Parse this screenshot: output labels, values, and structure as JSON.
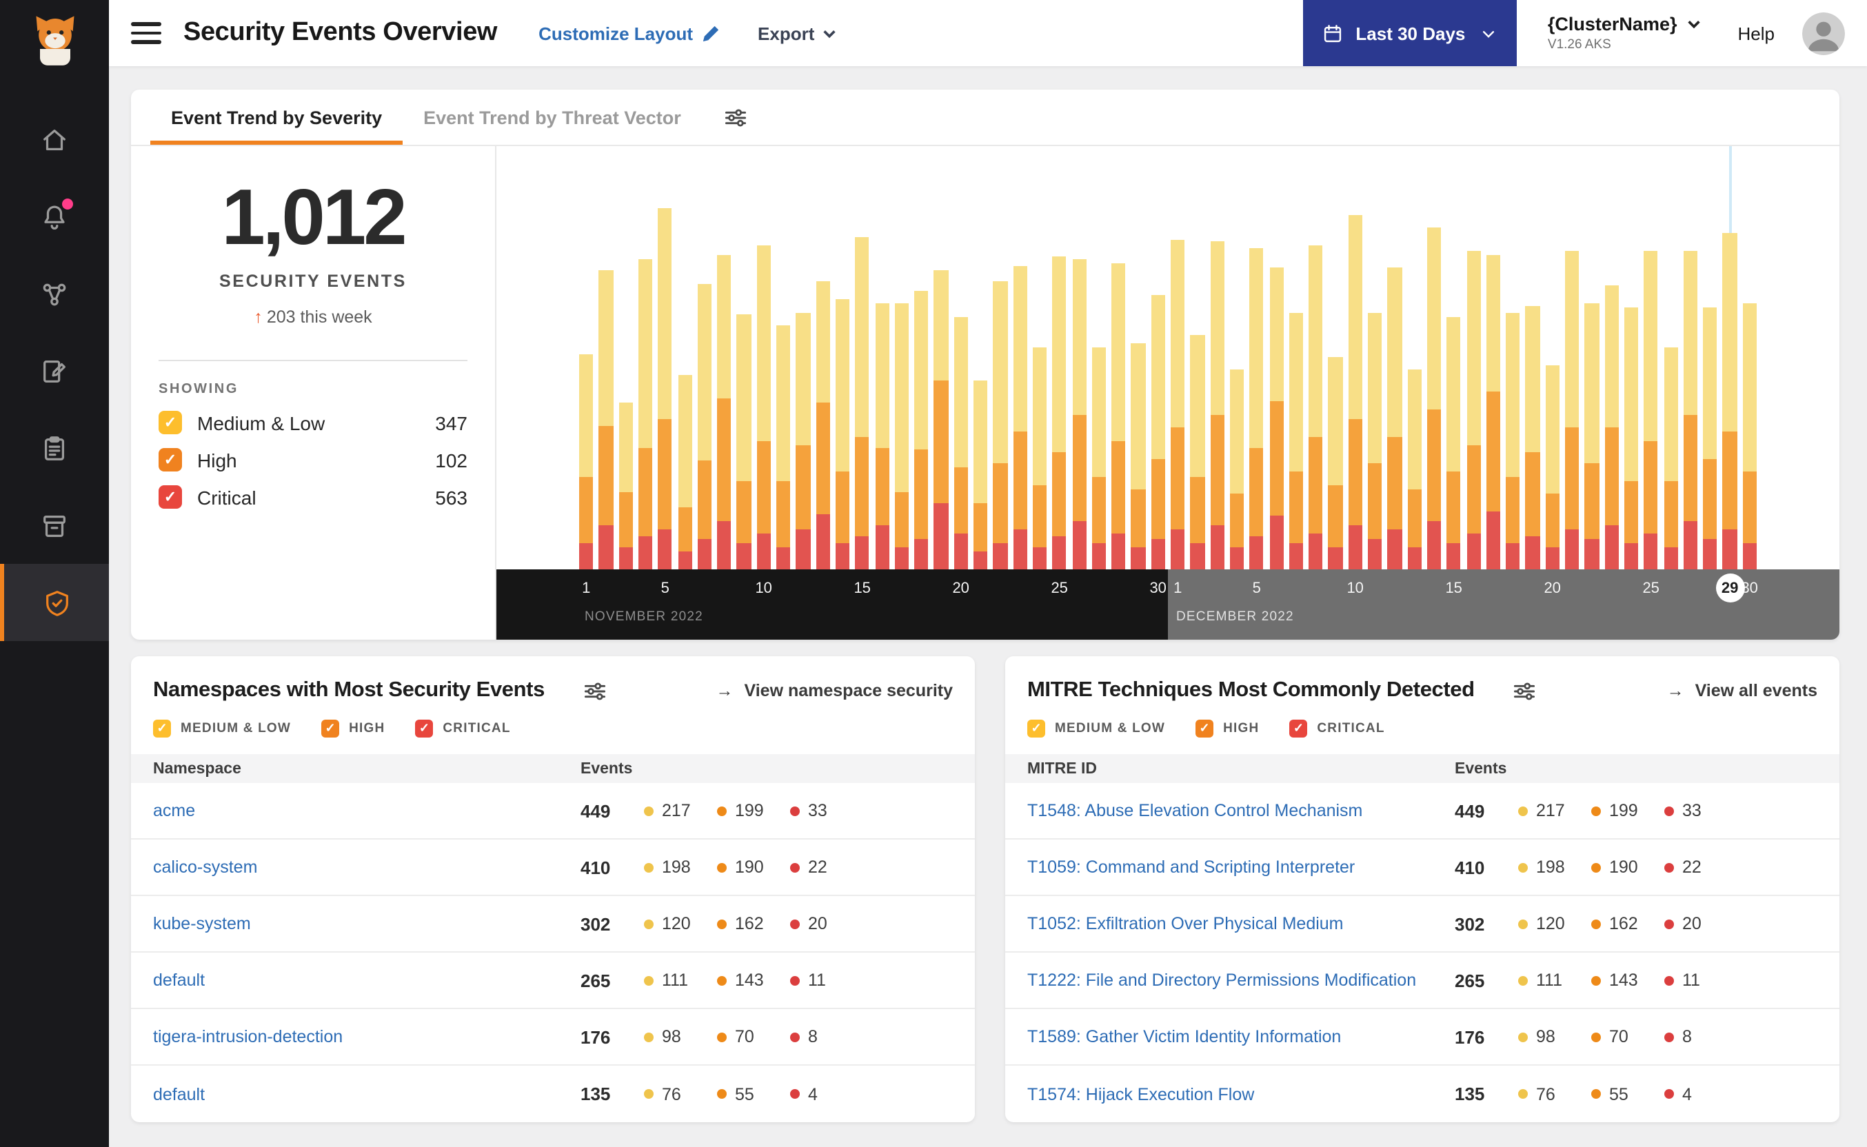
{
  "icons": {
    "check": "✓",
    "arrow_right": "→"
  },
  "colors": {
    "accent_orange": "#F0821F",
    "link_blue": "#2D6CB5",
    "button_navy": "#2B3990",
    "severity": {
      "medium_bar": "#F8DF87",
      "high_bar": "#F5A23C",
      "critical_bar": "#E25450",
      "medium_check": "#FDBE2D",
      "high_check": "#F0821F",
      "critical_check": "#E8463D",
      "medium_dot": "#EFC44C",
      "high_dot": "#EE8A18",
      "critical_dot": "#DB3E3E"
    }
  },
  "header": {
    "title": "Security Events Overview",
    "customize_layout_label": "Customize Layout",
    "export_label": "Export",
    "date_range_label": "Last 30 Days",
    "cluster_name": "{ClusterName}",
    "cluster_version": "V1.26 AKS",
    "help_label": "Help"
  },
  "trend_card": {
    "tabs": [
      {
        "label": "Event Trend by Severity"
      },
      {
        "label": "Event Trend by Threat Vector"
      }
    ],
    "total_events": "1,012",
    "total_caption": "SECURITY EVENTS",
    "delta_arrow": "↑",
    "delta_text": "203 this week",
    "showing_label": "SHOWING",
    "legend": [
      {
        "label": "Medium & Low",
        "count": "347",
        "key": "medium"
      },
      {
        "label": "High",
        "count": "102",
        "key": "high"
      },
      {
        "label": "Critical",
        "count": "563",
        "key": "critical"
      }
    ]
  },
  "chart_data": {
    "type": "bar",
    "stacked": true,
    "y_axis": "hidden",
    "legend_position": "left-panel",
    "months": [
      {
        "label": "NOVEMBER 2022",
        "days": 30,
        "ticks": [
          1,
          5,
          10,
          15,
          20,
          25,
          30
        ]
      },
      {
        "label": "DECEMBER 2022",
        "days": 30,
        "ticks": [
          1,
          5,
          10,
          15,
          20,
          25,
          30
        ]
      }
    ],
    "selected": {
      "month_index": 1,
      "day": 29
    },
    "series": [
      {
        "name": "Critical",
        "color_key": "critical_bar",
        "values": [
          12,
          20,
          10,
          15,
          18,
          8,
          14,
          22,
          12,
          16,
          10,
          18,
          25,
          12,
          15,
          20,
          10,
          14,
          30,
          16,
          8,
          12,
          18,
          10,
          15,
          22,
          12,
          16,
          10,
          14,
          18,
          12,
          20,
          10,
          15,
          24,
          12,
          16,
          10,
          20,
          14,
          18,
          10,
          22,
          12,
          16,
          26,
          12,
          15,
          10,
          18,
          14,
          20,
          12,
          16,
          10,
          22,
          14,
          18,
          12
        ]
      },
      {
        "name": "High",
        "color_key": "high_bar",
        "values": [
          30,
          45,
          25,
          40,
          50,
          20,
          35,
          55,
          28,
          42,
          30,
          38,
          50,
          32,
          45,
          35,
          25,
          40,
          55,
          30,
          22,
          36,
          44,
          28,
          38,
          48,
          30,
          42,
          26,
          36,
          46,
          30,
          50,
          24,
          40,
          52,
          32,
          44,
          28,
          48,
          34,
          42,
          26,
          50,
          32,
          40,
          54,
          30,
          38,
          24,
          46,
          34,
          44,
          28,
          42,
          30,
          48,
          36,
          44,
          32
        ]
      },
      {
        "name": "Medium & Low",
        "color_key": "medium_bar",
        "values": [
          55,
          70,
          40,
          85,
          95,
          60,
          80,
          65,
          75,
          88,
          70,
          60,
          55,
          78,
          90,
          65,
          85,
          72,
          50,
          68,
          55,
          82,
          75,
          62,
          88,
          70,
          58,
          80,
          66,
          74,
          85,
          64,
          78,
          56,
          90,
          60,
          72,
          86,
          58,
          92,
          68,
          76,
          54,
          82,
          70,
          88,
          62,
          74,
          66,
          58,
          80,
          72,
          64,
          78,
          86,
          60,
          74,
          68,
          90,
          76
        ]
      }
    ]
  },
  "namespaces_card": {
    "title": "Namespaces with Most Security Events",
    "view_link": "View namespace security",
    "filters": [
      {
        "label": "MEDIUM & LOW",
        "key": "medium"
      },
      {
        "label": "HIGH",
        "key": "high"
      },
      {
        "label": "CRITICAL",
        "key": "critical"
      }
    ],
    "columns": [
      "Namespace",
      "Events"
    ],
    "rows": [
      {
        "label": "acme",
        "total": "449",
        "medium": "217",
        "high": "199",
        "critical": "33"
      },
      {
        "label": "calico-system",
        "total": "410",
        "medium": "198",
        "high": "190",
        "critical": "22"
      },
      {
        "label": "kube-system",
        "total": "302",
        "medium": "120",
        "high": "162",
        "critical": "20"
      },
      {
        "label": "default",
        "total": "265",
        "medium": "111",
        "high": "143",
        "critical": "11"
      },
      {
        "label": "tigera-intrusion-detection",
        "total": "176",
        "medium": "98",
        "high": "70",
        "critical": "8"
      },
      {
        "label": "default",
        "total": "135",
        "medium": "76",
        "high": "55",
        "critical": "4"
      }
    ]
  },
  "mitre_card": {
    "title": "MITRE Techniques Most Commonly Detected",
    "view_link": "View all events",
    "filters": [
      {
        "label": "MEDIUM & LOW",
        "key": "medium"
      },
      {
        "label": "HIGH",
        "key": "high"
      },
      {
        "label": "CRITICAL",
        "key": "critical"
      }
    ],
    "columns": [
      "MITRE ID",
      "Events"
    ],
    "rows": [
      {
        "label": "T1548: Abuse Elevation Control Mechanism",
        "total": "449",
        "medium": "217",
        "high": "199",
        "critical": "33"
      },
      {
        "label": "T1059: Command and Scripting Interpreter",
        "total": "410",
        "medium": "198",
        "high": "190",
        "critical": "22"
      },
      {
        "label": "T1052: Exfiltration Over Physical Medium",
        "total": "302",
        "medium": "120",
        "high": "162",
        "critical": "20"
      },
      {
        "label": "T1222: File and Directory Permissions Modification",
        "total": "265",
        "medium": "111",
        "high": "143",
        "critical": "11"
      },
      {
        "label": "T1589: Gather Victim Identity Information",
        "total": "176",
        "medium": "98",
        "high": "70",
        "critical": "8"
      },
      {
        "label": "T1574: Hijack Execution Flow",
        "total": "135",
        "medium": "76",
        "high": "55",
        "critical": "4"
      }
    ]
  }
}
